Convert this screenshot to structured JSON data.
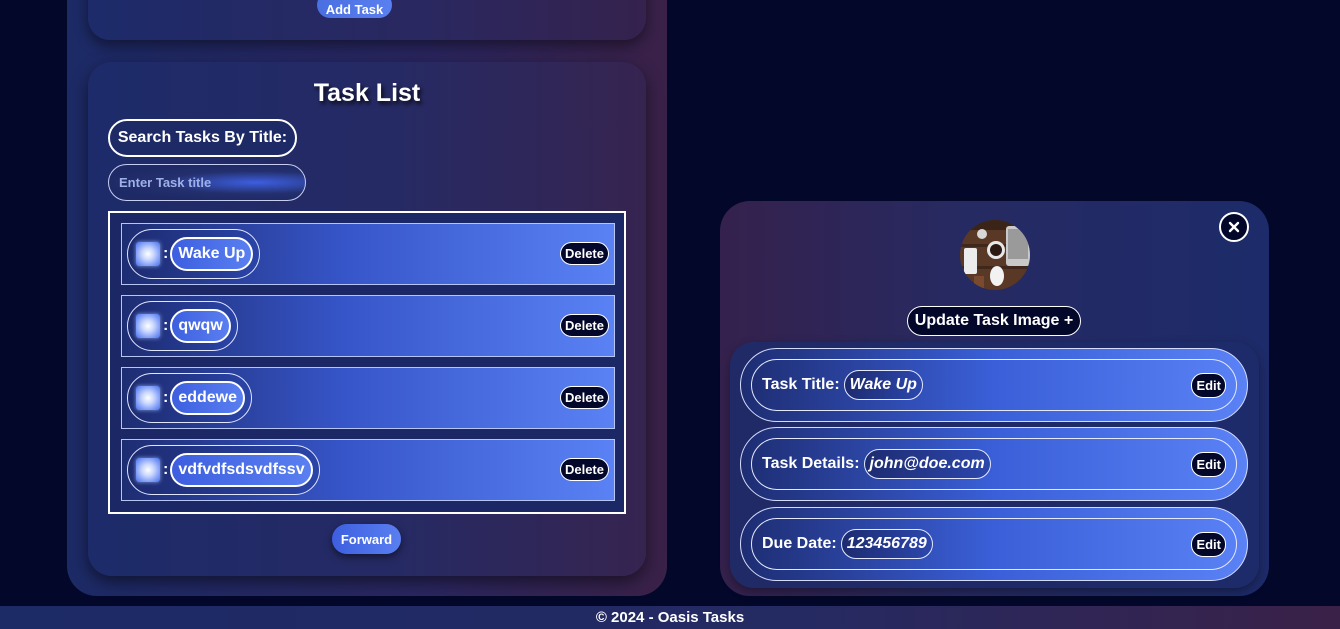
{
  "add_task": {
    "button_label": "Add Task"
  },
  "task_list": {
    "title": "Task List",
    "search_label": "Search Tasks By Title:",
    "search_placeholder": "Enter Task title",
    "separator": ":",
    "delete_label": "Delete",
    "items": [
      {
        "title": "Wake Up"
      },
      {
        "title": "qwqw"
      },
      {
        "title": "eddewe"
      },
      {
        "title": "vdfvdfsdsvdfssv"
      }
    ],
    "forward_label": "Forward"
  },
  "task_detail": {
    "close_icon": "close-icon",
    "update_image_label": "Update Task Image +",
    "edit_label": "Edit",
    "fields": [
      {
        "label": "Task Title:",
        "value": "Wake Up"
      },
      {
        "label": "Task Details:",
        "value": "john@doe.com"
      },
      {
        "label": "Due Date:",
        "value": "123456789"
      }
    ]
  },
  "footer": {
    "text": "© 2024 - Oasis Tasks"
  }
}
